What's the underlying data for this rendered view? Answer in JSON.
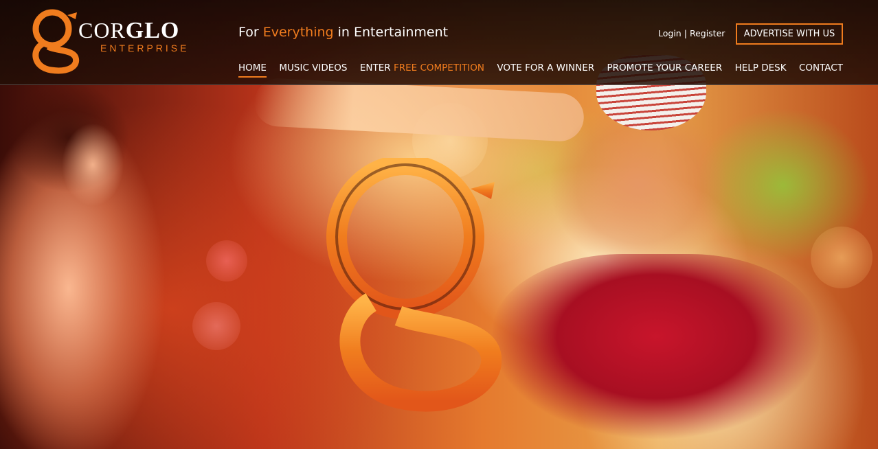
{
  "brand": {
    "name_light": "Cor",
    "name_bold": "Glo",
    "sub": "ENTERPRISE",
    "accent": "#f07c1e"
  },
  "tagline": {
    "before": "For ",
    "highlight": "Everything",
    "after": " in Entertainment"
  },
  "account": {
    "login": "Login",
    "separator": "|",
    "register": "Register"
  },
  "advertise_label": "ADVERTISE WITH US",
  "nav": {
    "home": "HOME",
    "music_videos": "MUSIC VIDEOS",
    "enter_prefix": "ENTER ",
    "enter_highlight": "FREE COMPETITION",
    "vote": "VOTE FOR A WINNER",
    "promote": "PROMOTE YOUR CAREER",
    "help": "HELP DESK",
    "contact": "CONTACT"
  },
  "hero": {
    "image": "dancers-with-g-logo",
    "colors": {
      "glow": "#e8a04a",
      "pants": "#c8152b",
      "dark": "#3b0d08"
    }
  }
}
